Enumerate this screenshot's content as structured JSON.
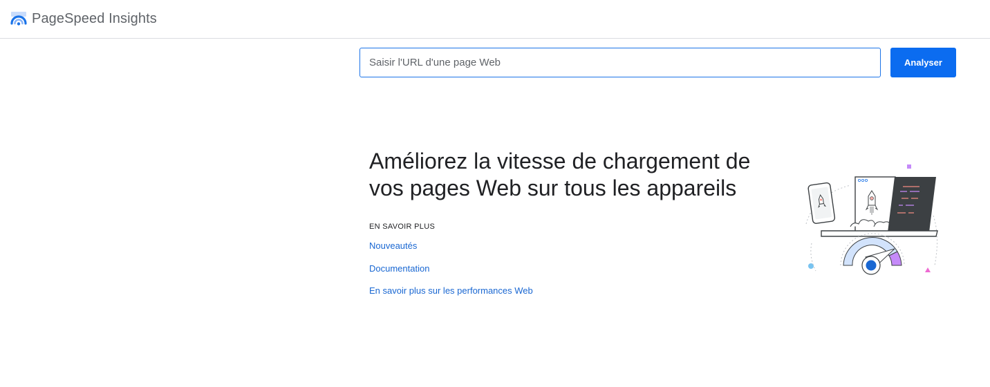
{
  "header": {
    "app_title": "PageSpeed Insights"
  },
  "search": {
    "placeholder": "Saisir l'URL d'une page Web",
    "value": "",
    "button_label": "Analyser"
  },
  "hero": {
    "title_line1": "Améliorez la vitesse de chargement de",
    "title_line2": "vos pages Web sur tous les appareils",
    "learn_more_label": "EN SAVOIR PLUS",
    "links": [
      {
        "label": "Nouveautés"
      },
      {
        "label": "Documentation"
      },
      {
        "label": "En savoir plus sur les performances Web"
      }
    ]
  },
  "colors": {
    "accent": "#1a73e8",
    "button": "#0b6cf0",
    "link": "#1967d2",
    "header_border": "#dadce0"
  },
  "icons": {
    "logo": "pagespeed-logo-icon",
    "illustration": "speed-gauge-devices-illustration"
  }
}
